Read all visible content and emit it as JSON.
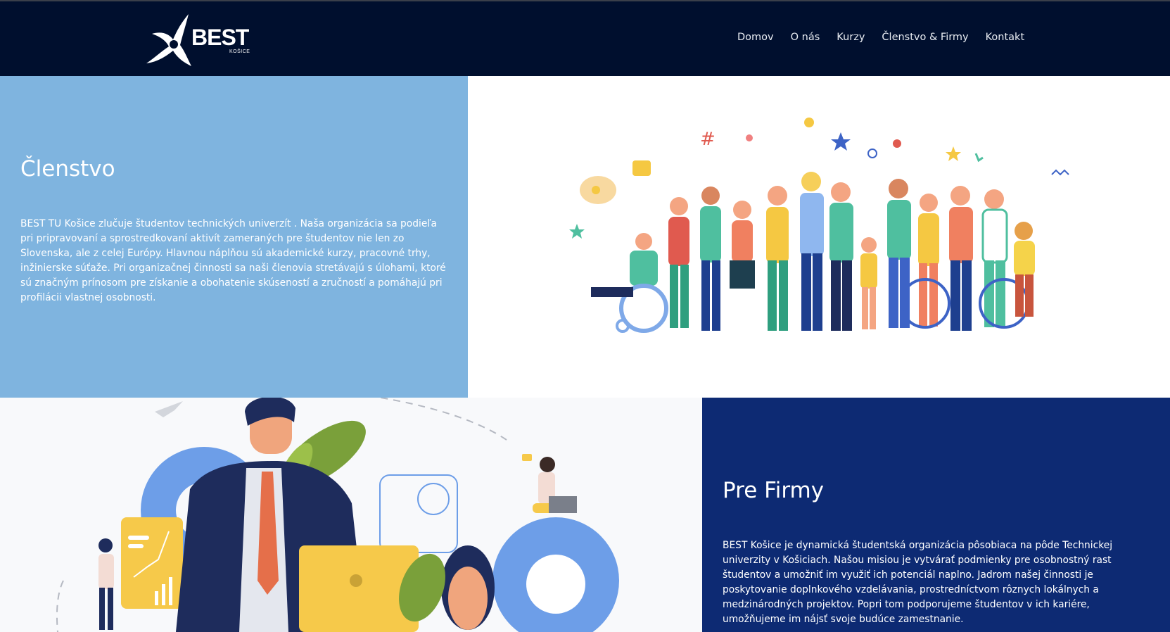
{
  "brand": {
    "name": "BEST",
    "city": "KOŠICE"
  },
  "nav": {
    "items": [
      "Domov",
      "O nás",
      "Kurzy",
      "Členstvo & Firmy",
      "Kontakt"
    ]
  },
  "membership": {
    "title": "Členstvo",
    "body": "BEST TU Košice zlučuje študentov technických univerzít . Naša organizácia sa podieľa pri pripravovaní a sprostredkovaní aktivít zameraných pre študentov nie len zo Slovenska, ale z celej Európy. Hlavnou náplňou sú akademické kurzy, pracovné trhy, inžinierske súťaže. Pri organizačnej činnosti sa naši členovia stretávajú s úlohami, ktoré sú značným prínosom pre získanie a obohatenie skúseností a zručností a pomáhajú pri profilácii vlastnej osobnosti."
  },
  "firms": {
    "title": "Pre Firmy",
    "body": "BEST Košice je dynamická študentská organizácia pôsobiaca na pôde Technickej univerzity v Košiciach. Našou misiou je vytvárať podmienky pre osobnostný rast študentov a umožniť im využiť ich potenciál naplno. Jadrom našej činnosti je poskytovanie doplnkového vzdelávania, prostredníctvom rôznych lokálnych a medzinárodných projektov. Popri tom podporujeme študentov v ich kariére, umožňujeme im nájsť svoje budúce zamestnanie."
  },
  "colors": {
    "header_bg": "#000f2e",
    "membership_bg": "#7fb4df",
    "firms_bg": "#0d2a73"
  },
  "illustrations": [
    "crowd-illustration",
    "business-team-illustration"
  ]
}
